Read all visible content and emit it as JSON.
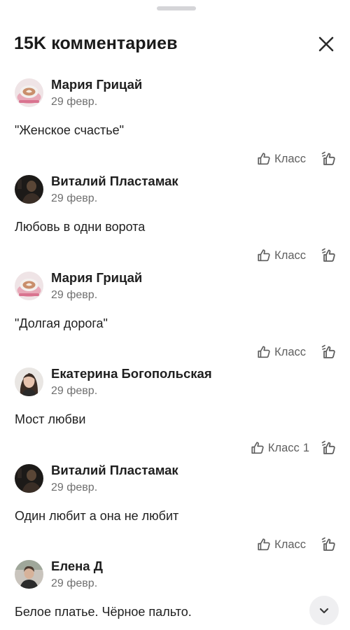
{
  "header": {
    "title": "15K комментариев"
  },
  "comments": [
    {
      "author": "Мария Грицай",
      "date": "29 февр.",
      "text": "\"Женское счастье\"",
      "like_label": "Класс",
      "like_count": ""
    },
    {
      "author": "Виталий Пластамак",
      "date": "29 февр.",
      "text": "Любовь в одни ворота",
      "like_label": "Класс",
      "like_count": ""
    },
    {
      "author": "Мария Грицай",
      "date": "29 февр.",
      "text": "\"Долгая дорога\"",
      "like_label": "Класс",
      "like_count": ""
    },
    {
      "author": "Екатерина Богопольская",
      "date": "29 февр.",
      "text": "Мост любви",
      "like_label": "Класс",
      "like_count": "1"
    },
    {
      "author": "Виталий Пластамак",
      "date": "29 февр.",
      "text": "Один любит а она не любит",
      "like_label": "Класс",
      "like_count": ""
    },
    {
      "author": "Елена Д",
      "date": "29 февр.",
      "text": "Белое платье. Чёрное пальто.",
      "like_label": "",
      "like_count": ""
    }
  ],
  "colors": {
    "text": "#1f1f1f",
    "secondary": "#6f6f6f",
    "icon": "#5e5e5e",
    "scroll_button_bg": "#efeff1"
  },
  "icons": {
    "close": "close-icon",
    "like": "thumb-up-icon",
    "reply": "reply-icon",
    "scroll": "chevron-down-icon"
  }
}
